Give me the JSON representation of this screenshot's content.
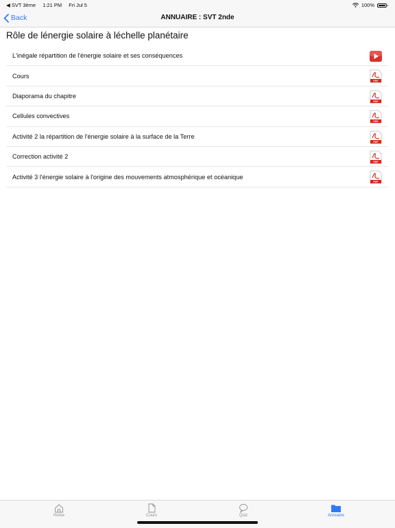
{
  "status_bar": {
    "back_app": "◀ SVT 3ème",
    "time": "1:21 PM",
    "date": "Fri Jul 5",
    "battery": "100%"
  },
  "nav": {
    "back_label": "Back",
    "title": "ANNUAIRE : SVT 2nde"
  },
  "section": {
    "title": "Rôle de lénergie solaire à léchelle planétaire"
  },
  "items": [
    {
      "label": "L'inégale répartition de l'énergie solaire et ses conséquences",
      "icon": "video-play-icon"
    },
    {
      "label": "Cours",
      "icon": "pdf-icon"
    },
    {
      "label": "Diaporama du chapitre",
      "icon": "pdf-icon"
    },
    {
      "label": "Cellules convectives",
      "icon": "pdf-icon"
    },
    {
      "label": "Activité 2 la répartition de l'énergie solaire à la surface de la Terre",
      "icon": "pdf-icon"
    },
    {
      "label": "Correction activité 2",
      "icon": "pdf-icon"
    },
    {
      "label": "Activité 3 l'énergie solaire à l'origine des mouvements atmosphérique et océanique",
      "icon": "pdf-icon"
    }
  ],
  "pdf_badge": "PDF",
  "tabs": [
    {
      "label": "Home",
      "icon": "home-icon"
    },
    {
      "label": "Cours",
      "icon": "document-icon"
    },
    {
      "label": "Quiz",
      "icon": "speech-bubble-icon"
    },
    {
      "label": "Annuaire",
      "icon": "folder-icon",
      "active": true
    }
  ],
  "colors": {
    "accent": "#2f7bf5",
    "pdf_red": "#d7261e",
    "video_red": "#d9302b"
  }
}
